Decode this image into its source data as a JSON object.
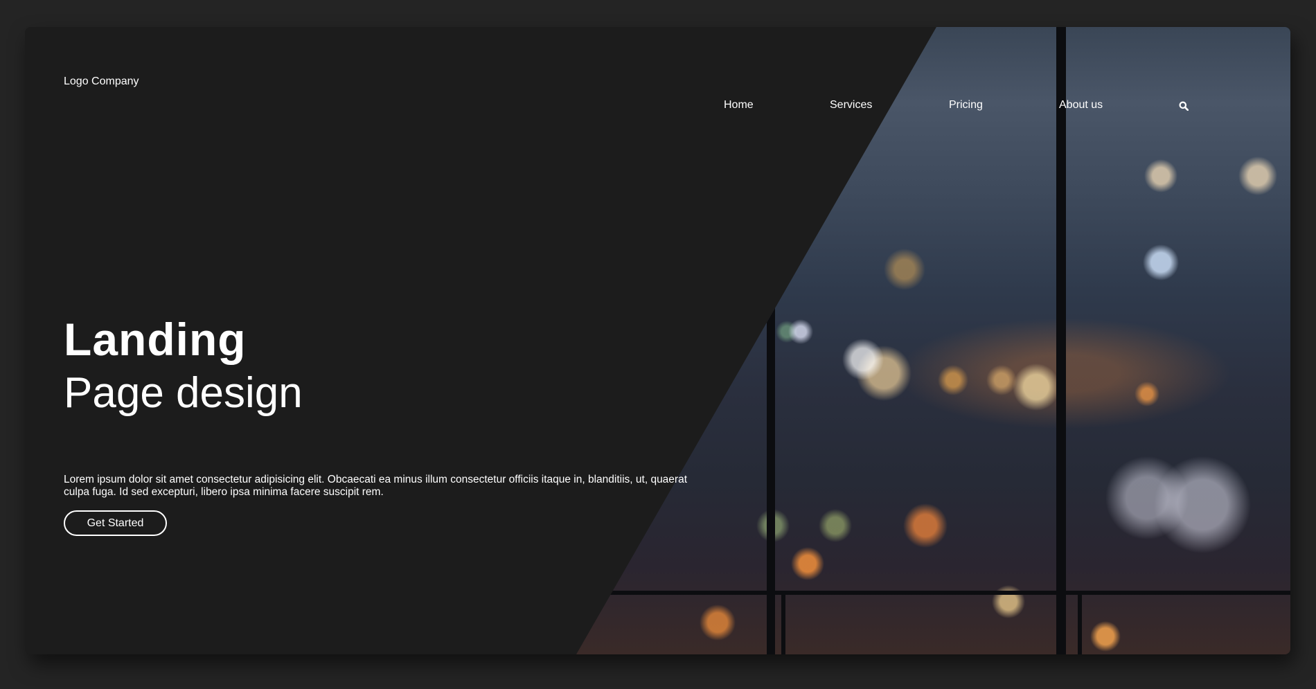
{
  "header": {
    "logo_text": "Logo Company",
    "nav": [
      {
        "label": "Home"
      },
      {
        "label": "Services"
      },
      {
        "label": "Pricing"
      },
      {
        "label": "About us"
      }
    ],
    "search_icon": "search-icon"
  },
  "hero": {
    "title_bold": "Landing",
    "title_light": "Page design",
    "description": "Lorem ipsum dolor sit amet consectetur adipisicing elit. Obcaecati ea minus illum consectetur officiis itaque in, blanditiis, ut, quaerat culpa fuga. Id sed excepturi, libero ipsa minima facere suscipit rem.",
    "cta_label": "Get Started",
    "image": "blurred night city skyline through window"
  },
  "colors": {
    "page_background": "#242424",
    "panel_background": "#1c1c1c",
    "text": "#ffffff"
  }
}
